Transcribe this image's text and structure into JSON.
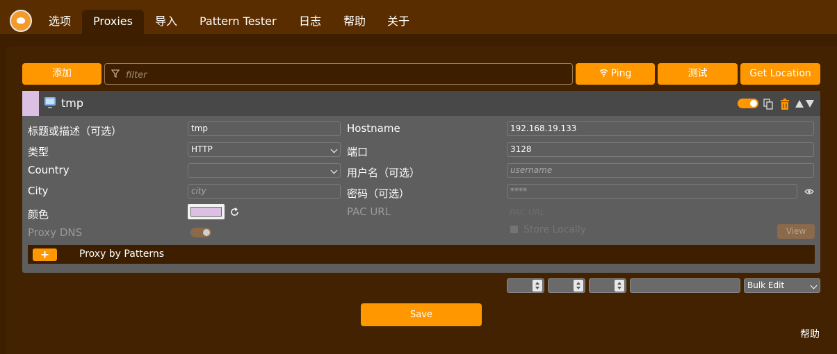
{
  "nav": {
    "tabs": [
      {
        "label": "选项"
      },
      {
        "label": "Proxies"
      },
      {
        "label": "导入"
      },
      {
        "label": "Pattern Tester"
      },
      {
        "label": "日志"
      },
      {
        "label": "帮助"
      },
      {
        "label": "关于"
      }
    ],
    "active_tab": "Proxies",
    "logo_icon": "fox-logo-icon"
  },
  "toolbar": {
    "add_label": "添加",
    "filter_placeholder": "filter",
    "ping_label": "Ping",
    "test_label": "测试",
    "get_location_label": "Get Location"
  },
  "proxy": {
    "title": "tmp",
    "color": "#dcc0e3",
    "enabled": true,
    "fields": {
      "title_label": "标题或描述（可选）",
      "title_value": "tmp",
      "type_label": "类型",
      "type_value": "HTTP",
      "country_label": "Country",
      "country_value": "",
      "city_label": "City",
      "city_placeholder": "city",
      "color_label": "颜色",
      "proxy_dns_label": "Proxy DNS",
      "hostname_label": "Hostname",
      "hostname_value": "192.168.19.133",
      "port_label": "端口",
      "port_value": "3128",
      "username_label": "用户名（可选）",
      "username_placeholder": "username",
      "password_label": "密码（可选）",
      "password_placeholder": "****",
      "pac_url_label": "PAC URL",
      "pac_url_placeholder": "PAC URL",
      "store_locally_label": "Store Locally",
      "view_label": "View"
    },
    "patterns": {
      "plus_label": "+",
      "label": "Proxy by Patterns"
    }
  },
  "bulk": {
    "select_value": "Bulk Edit"
  },
  "footer": {
    "save_label": "Save",
    "help_label": "帮助"
  },
  "colors": {
    "accent": "#ff9800",
    "background": "#3d1f00",
    "nav": "#5a2d00",
    "card": "#5e5e5e"
  }
}
